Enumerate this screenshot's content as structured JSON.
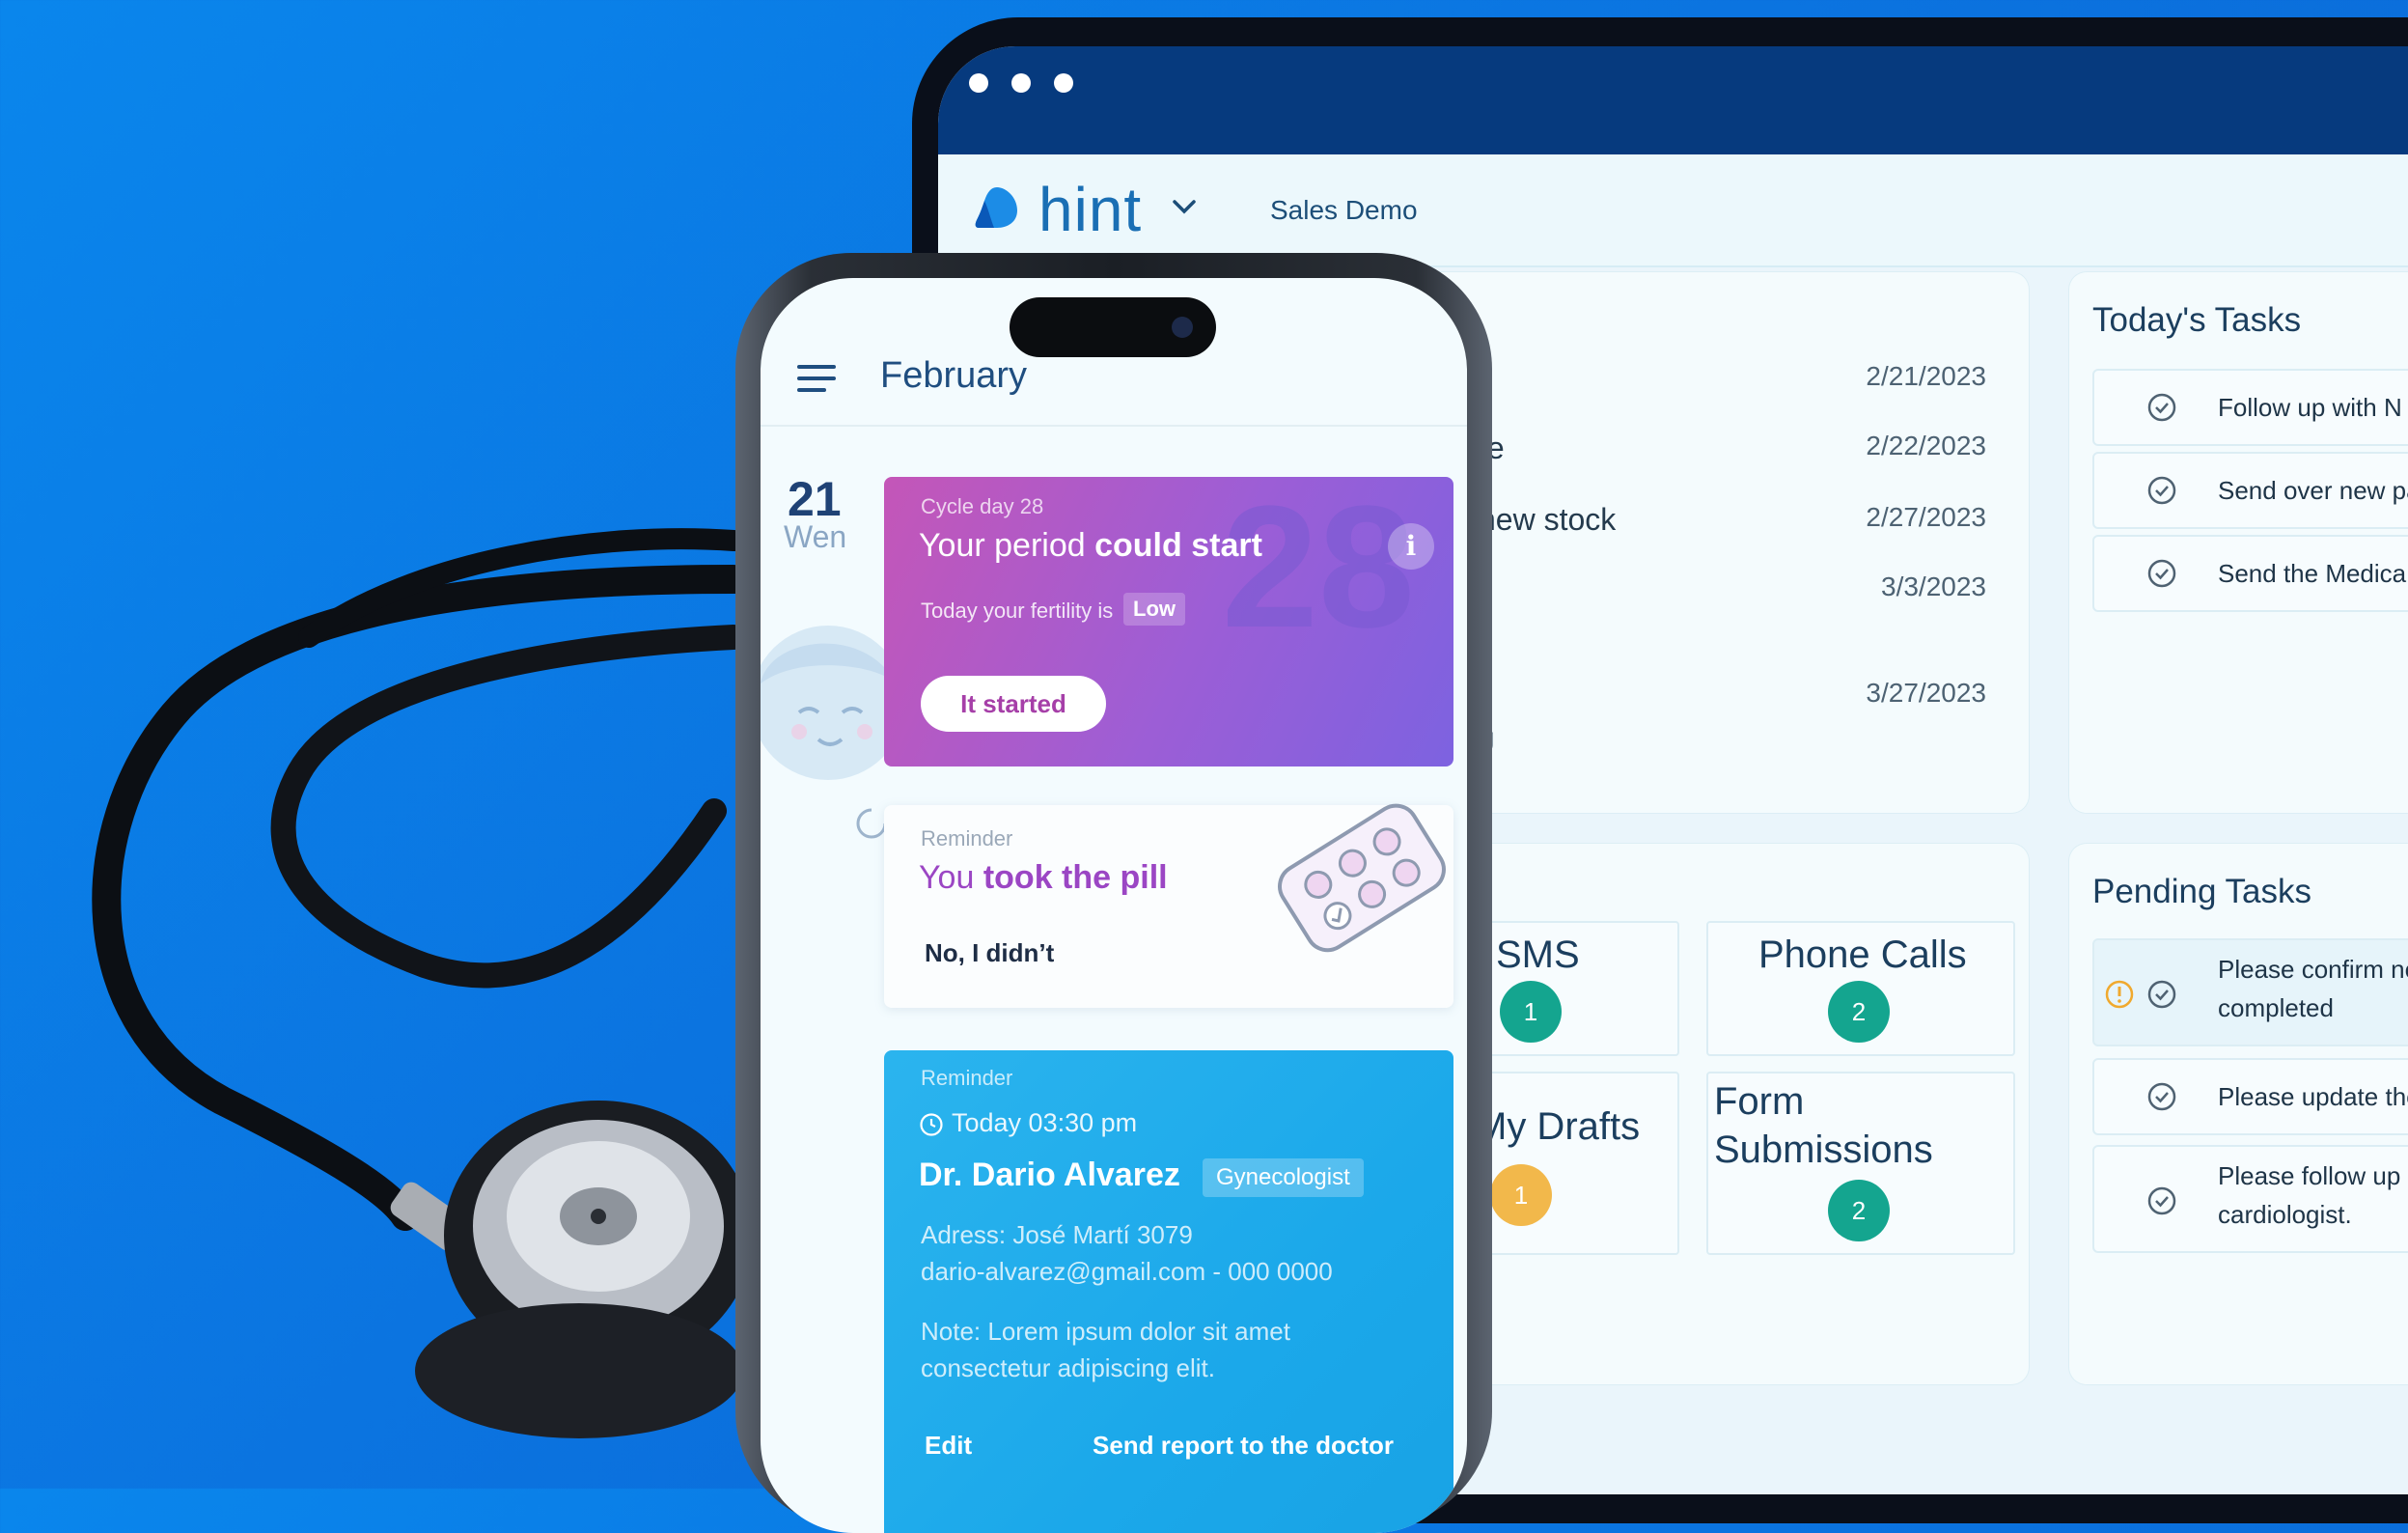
{
  "colors": {
    "background_blue": "#0b74e0",
    "browser_header": "#063a7e",
    "brand_blue": "#1a6fb4",
    "teal_badge": "#14a58f",
    "amber_badge": "#f2b84b",
    "period_card_start": "#c456b8",
    "period_card_end": "#7d62e0",
    "doctor_card": "#1ba8ea",
    "pill_headline": "#9b46c4"
  },
  "web_app": {
    "brand": "hint",
    "org_name": "Sales Demo",
    "dates_list": [
      {
        "label": "",
        "date": "2/21/2023"
      },
      {
        "label": "te",
        "date": "2/22/2023"
      },
      {
        "label": "new stock",
        "date": "2/27/2023"
      },
      {
        "label": "",
        "date": "3/3/2023"
      },
      {
        "label": "",
        "date": "3/27/2023"
      }
    ],
    "dates_trailing_fragment": "g",
    "todays_tasks": {
      "title": "Today's Tasks",
      "items": [
        "Follow up with N",
        "Send over new pa",
        "Send the Medica"
      ]
    },
    "pending_tasks": {
      "title": "Pending Tasks",
      "items": [
        "Please confirm ne completed",
        "Please update the",
        "Please follow up cardiologist."
      ]
    },
    "messages": {
      "sms": {
        "label": "SMS",
        "count": "1"
      },
      "phone_calls": {
        "label": "Phone Calls",
        "count": "2"
      },
      "my_drafts": {
        "label": "My Drafts",
        "count": "1"
      },
      "form_submissions": {
        "label": "Form Submissions",
        "count": "2"
      }
    }
  },
  "phone_app": {
    "month": "February",
    "day_number": "21",
    "day_name": "Wen",
    "period_card": {
      "background_number": "28",
      "eyebrow": "Cycle day 28",
      "headline_prefix": "Your period ",
      "headline_bold": "could start",
      "info_icon": "i",
      "fertility_text": "Today your fertility is",
      "fertility_level": "Low",
      "button": "It started"
    },
    "pill_card": {
      "eyebrow": "Reminder",
      "headline_prefix": "You ",
      "headline_bold": "took the pill",
      "action": "No, I didn’t"
    },
    "doctor_card": {
      "eyebrow": "Reminder",
      "when": "Today  03:30 pm",
      "doctor_name": "Dr. Dario Alvarez",
      "specialty": "Gynecologist",
      "address": "Adress: José Martí 3079",
      "contact": "dario-alvarez@gmail.com  -  000 0000",
      "note_line1": "Note: Lorem ipsum dolor sit amet",
      "note_line2": "consectetur adipiscing elit.",
      "edit": "Edit",
      "send_report": "Send report to the doctor"
    }
  }
}
